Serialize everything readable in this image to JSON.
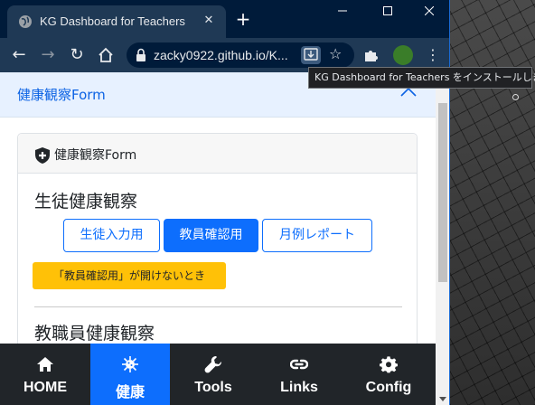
{
  "browser": {
    "tab_title": "KG Dashboard for Teachers",
    "tab_close": "✕",
    "new_tab": "+",
    "url": "zacky0922.github.io/K...",
    "tooltip": "KG Dashboard for Teachers をインストールします",
    "menu": "⋮",
    "window": {
      "minimize": "—",
      "maximize": "☐",
      "close": "✕"
    },
    "nav": {
      "back": "←",
      "forward": "→",
      "reload": "↻",
      "home": "⌂"
    },
    "star": "☆"
  },
  "accordion": {
    "title": "健康観察Form"
  },
  "card": {
    "title": "健康観察Form",
    "section1": "生徒健康観察",
    "buttons": [
      "生徒入力用",
      "教員確認用",
      "月例レポート"
    ],
    "warning": "「教員確認用」が開けないとき",
    "section2": "教職員健康観察"
  },
  "bottom_nav": {
    "items": [
      {
        "label": "HOME",
        "icon": "home-icon"
      },
      {
        "label": "健康",
        "icon": "virus-icon"
      },
      {
        "label": "Tools",
        "icon": "wrench-icon"
      },
      {
        "label": "Links",
        "icon": "link-icon"
      },
      {
        "label": "Config",
        "icon": "gear-icon"
      }
    ],
    "active_index": 1
  },
  "colors": {
    "primary": "#0d6efd",
    "warning": "#ffc107",
    "nav_bg": "#212529",
    "titlebar": "#001b3a",
    "toolbar": "#1f3955"
  }
}
